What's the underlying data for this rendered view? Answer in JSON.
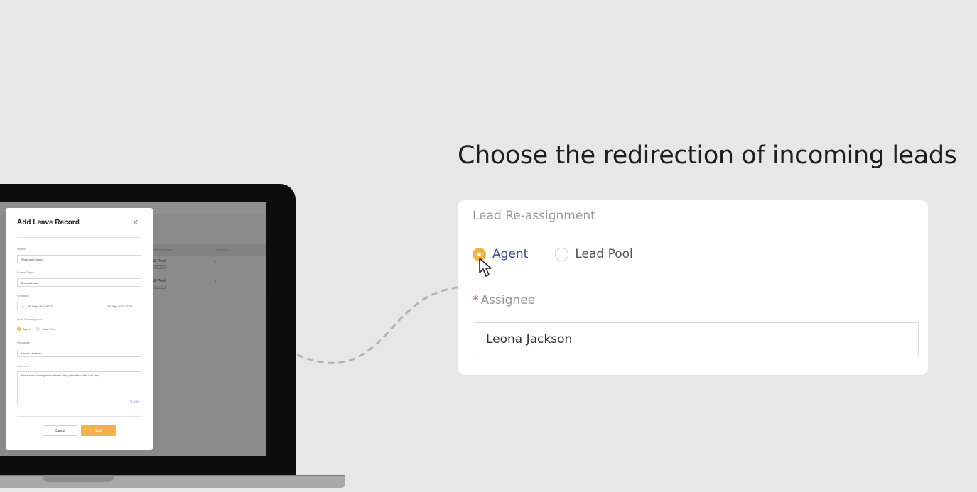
{
  "headline": "Choose the redirection of incoming leads",
  "card": {
    "title": "Lead Re-assignment",
    "radio_options": [
      {
        "label": "Agent",
        "selected": true
      },
      {
        "label": "Lead Pool",
        "selected": false
      }
    ],
    "assignee_label": "Assignee",
    "required_mark": "*",
    "assignee_value": "Leona Jackson"
  },
  "laptop": {
    "background_table": {
      "headers": [
        "Lead Re-assignee",
        "Comment"
      ],
      "rows": [
        {
          "pool": "UAE Pool",
          "tag": "LeadPool",
          "comment": "/"
        },
        {
          "pool": "UAE Pool",
          "tag": "LeadPool",
          "comment": "/"
        }
      ]
    },
    "modal": {
      "title": "Add Leave Record",
      "agent_label": "Agent",
      "agent_value": "Shannon Lothrar",
      "leave_type_label": "Leave Type",
      "leave_type_value": "Annual Leave",
      "duration_label": "Duration",
      "duration_start": "08 May, 2024 07:00",
      "duration_separator": "-",
      "duration_end": "15 May, 2024 07:00",
      "reassignment_label": "Lead Re-assignment",
      "radio_agent": "Agent",
      "radio_pool": "Lead Pool",
      "assignee_label": "Assignee",
      "assignee_value": "Leona Jackson",
      "comment_label": "Comment",
      "comment_value": "Please send incoming leads relevant listing information while I am away.",
      "comment_count": "75 / 250",
      "cancel_label": "Cancel",
      "save_label": "Save",
      "required_mark": "*"
    }
  },
  "colors": {
    "accent": "#f5b245",
    "required": "#e04b4b",
    "agent_text": "#3b4a8c"
  }
}
